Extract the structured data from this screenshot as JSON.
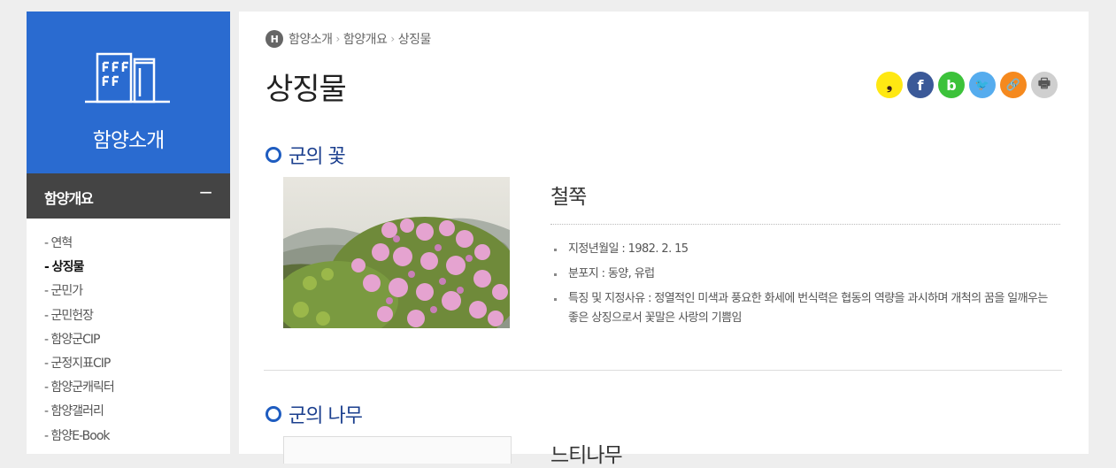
{
  "sidebar": {
    "title": "함양소개",
    "category": "함양개요",
    "toggle": "−",
    "items": [
      {
        "label": "- 연혁"
      },
      {
        "label": "- 상징물"
      },
      {
        "label": "- 군민가"
      },
      {
        "label": "- 군민헌장"
      },
      {
        "label": "- 함양군CIP"
      },
      {
        "label": "- 군정지표CIP"
      },
      {
        "label": "- 함양군캐릭터"
      },
      {
        "label": "- 함양갤러리"
      },
      {
        "label": "- 함양E-Book"
      }
    ]
  },
  "breadcrumb": {
    "home": "H",
    "items": [
      "함양소개",
      "함양개요",
      "상징물"
    ]
  },
  "page_title": "상징물",
  "share": {
    "kakao": "❟",
    "facebook": "f",
    "band": "b",
    "twitter": "🐦",
    "link": "🔗",
    "print": "🖶",
    "colors": {
      "kakao": "#ffe812",
      "facebook": "#3b5998",
      "band": "#3cc23a",
      "twitter": "#55acee",
      "link": "#f5891e",
      "print": "#cfcfcf"
    }
  },
  "flower_section": {
    "heading": "군의 꽃",
    "name": "철쭉",
    "facts": [
      "지정년월일 : 1982. 2. 15",
      "분포지 : 동양, 유럽",
      "특징 및 지정사유 : 정열적인 미색과 풍요한 화세에 번식력은 협동의 역량을 과시하며 개척의 꿈을 일깨우는 좋은 상징으로서 꽃말은 사랑의 기쁨임"
    ]
  },
  "tree_section": {
    "heading": "군의 나무",
    "name": "느티나무"
  },
  "colors": {
    "accent": "#2a6bd0",
    "heading": "#1b3f8e"
  }
}
